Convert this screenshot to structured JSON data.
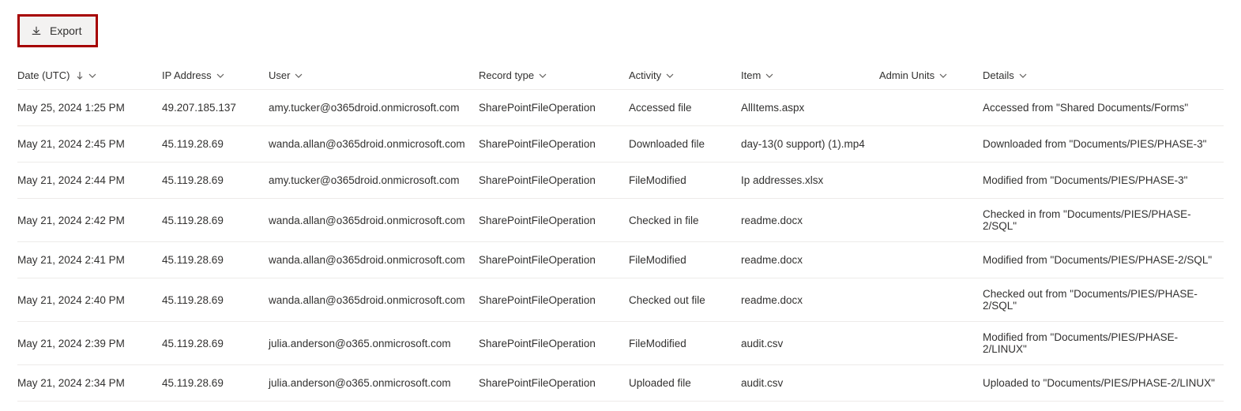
{
  "toolbar": {
    "export_label": "Export"
  },
  "headers": {
    "date": "Date (UTC)",
    "ip": "IP Address",
    "user": "User",
    "record": "Record type",
    "activity": "Activity",
    "item": "Item",
    "admin": "Admin Units",
    "details": "Details"
  },
  "rows": [
    {
      "date": "May 25, 2024 1:25 PM",
      "ip": "49.207.185.137",
      "user": "amy.tucker@o365droid.onmicrosoft.com",
      "record": "SharePointFileOperation",
      "activity": "Accessed file",
      "item": "AllItems.aspx",
      "admin": "",
      "details": "Accessed from \"Shared Documents/Forms\""
    },
    {
      "date": "May 21, 2024 2:45 PM",
      "ip": "45.119.28.69",
      "user": "wanda.allan@o365droid.onmicrosoft.com",
      "record": "SharePointFileOperation",
      "activity": "Downloaded file",
      "item": "day-13(0 support) (1).mp4",
      "admin": "",
      "details": "Downloaded from \"Documents/PIES/PHASE-3\""
    },
    {
      "date": "May 21, 2024 2:44 PM",
      "ip": "45.119.28.69",
      "user": "amy.tucker@o365droid.onmicrosoft.com",
      "record": "SharePointFileOperation",
      "activity": "FileModified",
      "item": "Ip addresses.xlsx",
      "admin": "",
      "details": "Modified from \"Documents/PIES/PHASE-3\""
    },
    {
      "date": "May 21, 2024 2:42 PM",
      "ip": "45.119.28.69",
      "user": "wanda.allan@o365droid.onmicrosoft.com",
      "record": "SharePointFileOperation",
      "activity": "Checked in file",
      "item": "readme.docx",
      "admin": "",
      "details": "Checked in from \"Documents/PIES/PHASE-2/SQL\""
    },
    {
      "date": "May 21, 2024 2:41 PM",
      "ip": "45.119.28.69",
      "user": "wanda.allan@o365droid.onmicrosoft.com",
      "record": "SharePointFileOperation",
      "activity": "FileModified",
      "item": "readme.docx",
      "admin": "",
      "details": "Modified from \"Documents/PIES/PHASE-2/SQL\""
    },
    {
      "date": "May 21, 2024 2:40 PM",
      "ip": "45.119.28.69",
      "user": "wanda.allan@o365droid.onmicrosoft.com",
      "record": "SharePointFileOperation",
      "activity": "Checked out file",
      "item": "readme.docx",
      "admin": "",
      "details": "Checked out from \"Documents/PIES/PHASE-2/SQL\""
    },
    {
      "date": "May 21, 2024 2:39 PM",
      "ip": "45.119.28.69",
      "user": "julia.anderson@o365.onmicrosoft.com",
      "record": "SharePointFileOperation",
      "activity": "FileModified",
      "item": "audit.csv",
      "admin": "",
      "details": "Modified from \"Documents/PIES/PHASE-2/LINUX\""
    },
    {
      "date": "May 21, 2024 2:34 PM",
      "ip": "45.119.28.69",
      "user": "julia.anderson@o365.onmicrosoft.com",
      "record": "SharePointFileOperation",
      "activity": "Uploaded file",
      "item": "audit.csv",
      "admin": "",
      "details": "Uploaded to \"Documents/PIES/PHASE-2/LINUX\""
    }
  ]
}
